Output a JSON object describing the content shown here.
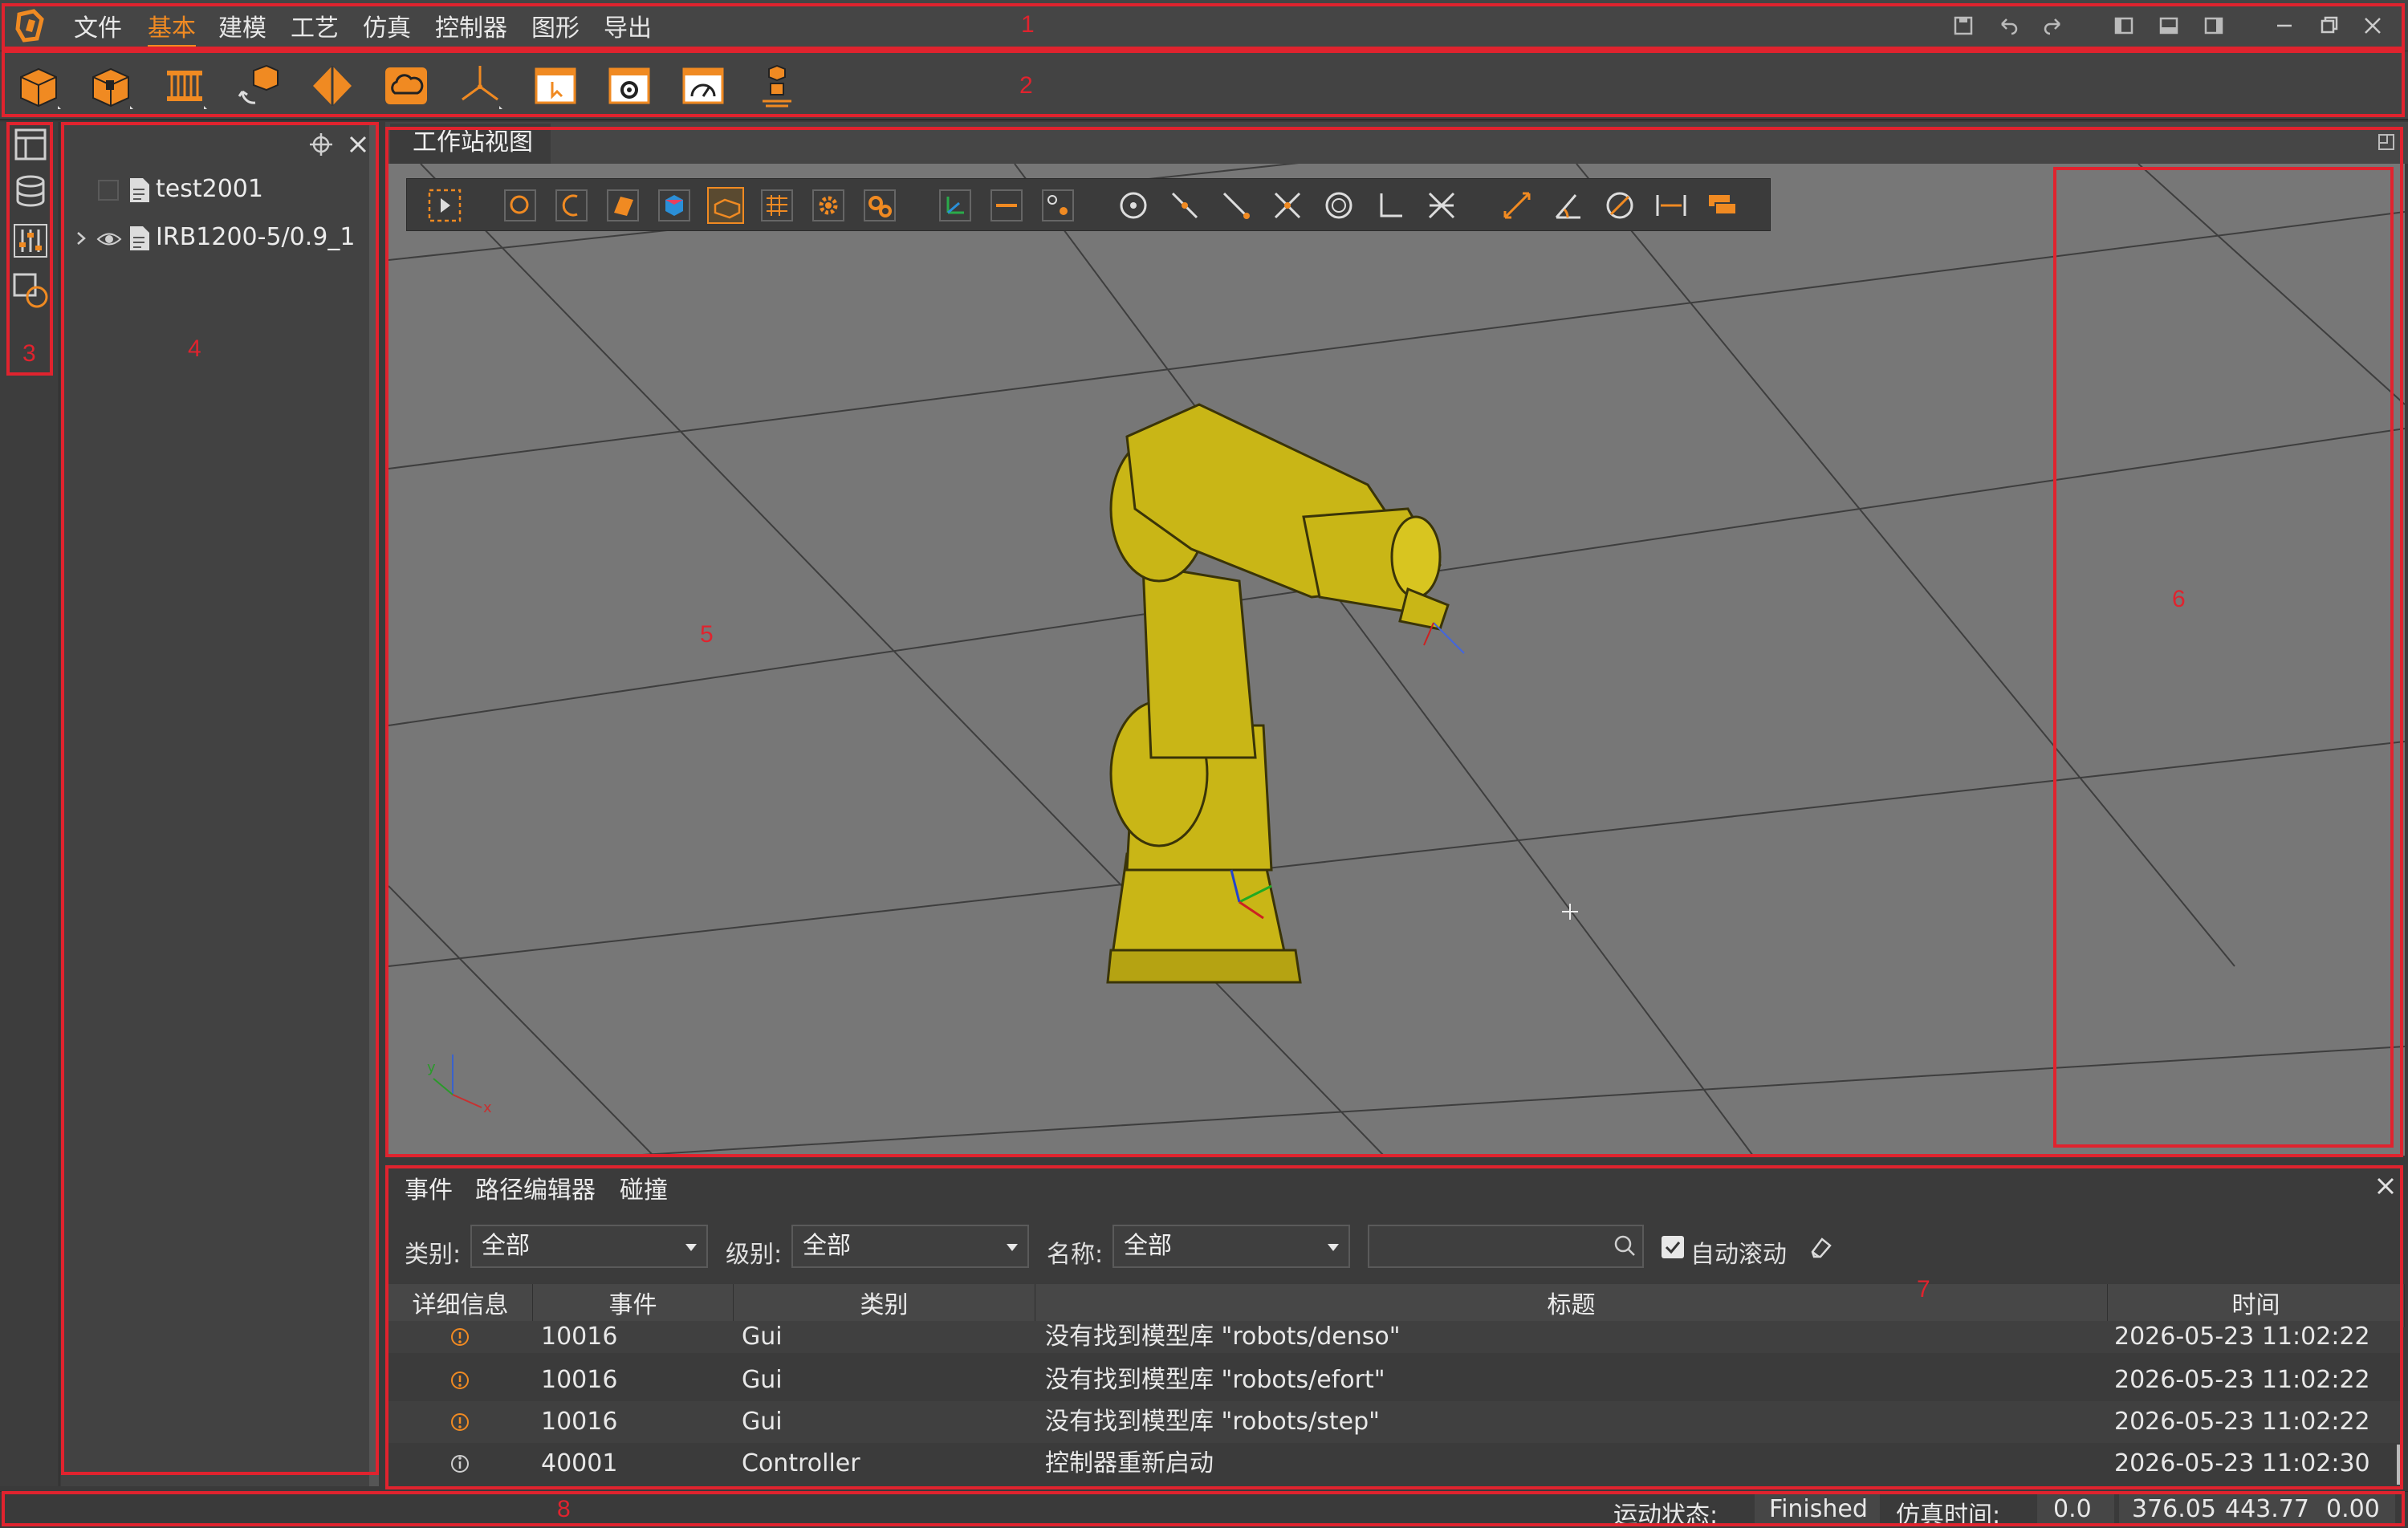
{
  "menu": {
    "items": [
      "文件",
      "基本",
      "建模",
      "工艺",
      "仿真",
      "控制器",
      "图形",
      "导出"
    ],
    "active_index": 1
  },
  "colors": {
    "accent": "#f08a22",
    "annotation": "#e0232e",
    "robot": "#c8b414"
  },
  "ribbon": {
    "buttons": [
      "box-model-icon",
      "box-lock-icon",
      "rack-icon",
      "rotate-cube-icon",
      "diamond-icon",
      "cloud-icon",
      "axis-frame-icon",
      "window-cursor-icon",
      "window-gear-icon",
      "gauge-icon",
      "robot-stack-icon"
    ]
  },
  "sidebar": {
    "icons": [
      "layout-icon",
      "database-icon",
      "sliders-icon",
      "shape-icon"
    ]
  },
  "tree": {
    "items": [
      {
        "label": "test2001"
      },
      {
        "label": "IRB1200-5/0.9_1"
      }
    ]
  },
  "viewport": {
    "tab": "工作站视图",
    "axes_labels": {
      "y": "y",
      "x": "x"
    }
  },
  "events": {
    "tabs": [
      "事件",
      "路径编辑器",
      "碰撞"
    ],
    "filters": {
      "category_label": "类别:",
      "category_value": "全部",
      "level_label": "级别:",
      "level_value": "全部",
      "name_label": "名称:",
      "name_value": "全部",
      "search_value": "",
      "autoscroll_label": "自动滚动",
      "autoscroll_checked": true
    },
    "columns": [
      "详细信息",
      "事件",
      "类别",
      "标题",
      "时间"
    ],
    "rows": [
      {
        "event": "10016",
        "category": "Gui",
        "title": "没有找到模型库 \"robots/denso\"",
        "time": "2026-05-23 11:02:22",
        "level": "warning"
      },
      {
        "event": "10016",
        "category": "Gui",
        "title": "没有找到模型库 \"robots/efort\"",
        "time": "2026-05-23 11:02:22",
        "level": "warning"
      },
      {
        "event": "10016",
        "category": "Gui",
        "title": "没有找到模型库 \"robots/step\"",
        "time": "2026-05-23 11:02:22",
        "level": "warning"
      },
      {
        "event": "40001",
        "category": "Controller",
        "title": "控制器重新启动",
        "time": "2026-05-23 11:02:30",
        "level": "info"
      }
    ]
  },
  "statusbar": {
    "motion_label": "运动状态:",
    "motion_value": "Finished",
    "sim_time_label": "仿真时间:",
    "sim_time_value": "0.0",
    "coord_x": "376.05",
    "coord_y": "443.77",
    "coord_z": "0.00"
  },
  "annotations": [
    "1",
    "2",
    "3",
    "4",
    "5",
    "6",
    "7",
    "8"
  ]
}
